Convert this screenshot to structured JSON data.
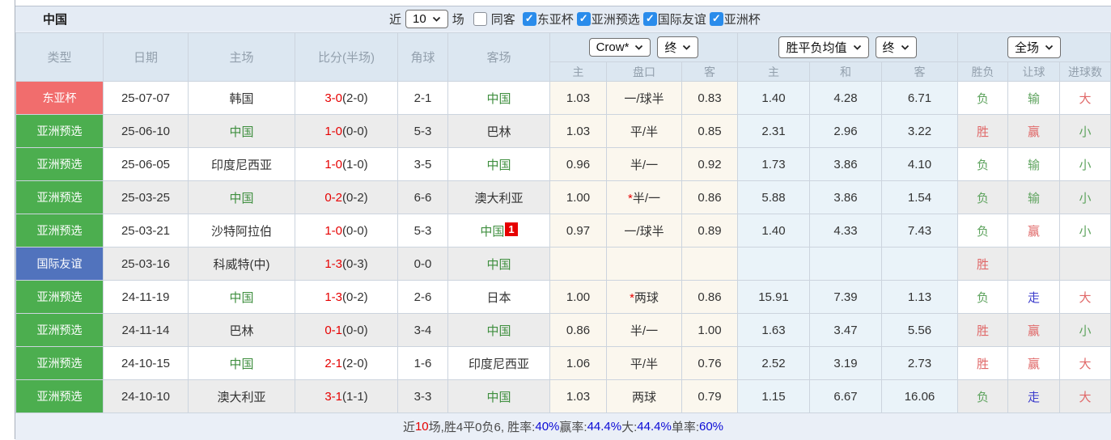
{
  "page": {
    "title": "中国",
    "topbar": {
      "recent_label": "近",
      "recent_count": "10",
      "unit_label": "场",
      "same_away_label": "同客",
      "same_away_checked": false,
      "check_glyph": "✓",
      "filters": [
        {
          "label": "东亚杯",
          "checked": true
        },
        {
          "label": "亚洲预选",
          "checked": true
        },
        {
          "label": "国际友谊",
          "checked": true
        },
        {
          "label": "亚洲杯",
          "checked": true
        }
      ]
    },
    "controls": {
      "company_select": "Crow*",
      "time_select_1": "终",
      "avg_select": "胜平负均值",
      "time_select_2": "终",
      "scope_select": "全场"
    },
    "columns": {
      "type": "类型",
      "date": "日期",
      "home": "主场",
      "score": "比分(半场)",
      "corner": "角球",
      "away": "客场",
      "odds_home": "主",
      "handicap": "盘口",
      "odds_away": "客",
      "avg_home": "主",
      "avg_draw": "和",
      "avg_away": "客",
      "result_wl": "胜负",
      "result_handicap": "让球",
      "result_goals": "进球数"
    },
    "colors": {
      "badge_red": "#f16d6d",
      "badge_green": "#4cae4f",
      "badge_blue": "#5173bd",
      "score_red": "#e60000",
      "team_green": "#3e8e3e",
      "result_red": "#e06868",
      "result_green": "#5ea35e",
      "result_blue": "#3c3ccc",
      "odds_bg_cream": "#fbf7ee",
      "odds_bg_blue": "#eaf3f9",
      "checkbox_blue": "#2a8ceb"
    },
    "rows": [
      {
        "type": "东亚杯",
        "type_color": "red",
        "date": "25-07-07",
        "home": "韩国",
        "home_cn": false,
        "score_ft": "3-0",
        "score_ht": "(2-0)",
        "corner": "2-1",
        "away": "中国",
        "away_cn": true,
        "away_badge": "",
        "odds1": "1.03",
        "hstar": false,
        "handicap": "一/球半",
        "odds2": "0.83",
        "avg1": "1.40",
        "avg2": "4.28",
        "avg3": "6.71",
        "wl": "负",
        "wl_c": "g",
        "let": "输",
        "let_c": "g",
        "goal": "大",
        "goal_c": "r"
      },
      {
        "type": "亚洲预选",
        "type_color": "green",
        "date": "25-06-10",
        "home": "中国",
        "home_cn": true,
        "score_ft": "1-0",
        "score_ht": "(0-0)",
        "corner": "5-3",
        "away": "巴林",
        "away_cn": false,
        "away_badge": "",
        "odds1": "1.03",
        "hstar": false,
        "handicap": "平/半",
        "odds2": "0.85",
        "avg1": "2.31",
        "avg2": "2.96",
        "avg3": "3.22",
        "wl": "胜",
        "wl_c": "r",
        "let": "赢",
        "let_c": "r",
        "goal": "小",
        "goal_c": "g"
      },
      {
        "type": "亚洲预选",
        "type_color": "green",
        "date": "25-06-05",
        "home": "印度尼西亚",
        "home_cn": false,
        "score_ft": "1-0",
        "score_ht": "(1-0)",
        "corner": "3-5",
        "away": "中国",
        "away_cn": true,
        "away_badge": "",
        "odds1": "0.96",
        "hstar": false,
        "handicap": "半/一",
        "odds2": "0.92",
        "avg1": "1.73",
        "avg2": "3.86",
        "avg3": "4.10",
        "wl": "负",
        "wl_c": "g",
        "let": "输",
        "let_c": "g",
        "goal": "小",
        "goal_c": "g"
      },
      {
        "type": "亚洲预选",
        "type_color": "green",
        "date": "25-03-25",
        "home": "中国",
        "home_cn": true,
        "score_ft": "0-2",
        "score_ht": "(0-2)",
        "corner": "6-6",
        "away": "澳大利亚",
        "away_cn": false,
        "away_badge": "",
        "odds1": "1.00",
        "hstar": true,
        "handicap": "半/一",
        "odds2": "0.86",
        "avg1": "5.88",
        "avg2": "3.86",
        "avg3": "1.54",
        "wl": "负",
        "wl_c": "g",
        "let": "输",
        "let_c": "g",
        "goal": "小",
        "goal_c": "g"
      },
      {
        "type": "亚洲预选",
        "type_color": "green",
        "date": "25-03-21",
        "home": "沙特阿拉伯",
        "home_cn": false,
        "score_ft": "1-0",
        "score_ht": "(0-0)",
        "corner": "5-3",
        "away": "中国",
        "away_cn": true,
        "away_badge": "1",
        "odds1": "0.97",
        "hstar": false,
        "handicap": "一/球半",
        "odds2": "0.89",
        "avg1": "1.40",
        "avg2": "4.33",
        "avg3": "7.43",
        "wl": "负",
        "wl_c": "g",
        "let": "赢",
        "let_c": "r",
        "goal": "小",
        "goal_c": "g"
      },
      {
        "type": "国际友谊",
        "type_color": "blue",
        "date": "25-03-16",
        "home": "科威特(中)",
        "home_cn": false,
        "score_ft": "1-3",
        "score_ht": "(0-3)",
        "corner": "0-0",
        "away": "中国",
        "away_cn": true,
        "away_badge": "",
        "odds1": "",
        "hstar": false,
        "handicap": "",
        "odds2": "",
        "avg1": "",
        "avg2": "",
        "avg3": "",
        "wl": "胜",
        "wl_c": "r",
        "let": "",
        "let_c": "g",
        "goal": "",
        "goal_c": "g"
      },
      {
        "type": "亚洲预选",
        "type_color": "green",
        "date": "24-11-19",
        "home": "中国",
        "home_cn": true,
        "score_ft": "1-3",
        "score_ht": "(0-2)",
        "corner": "2-6",
        "away": "日本",
        "away_cn": false,
        "away_badge": "",
        "odds1": "1.00",
        "hstar": true,
        "handicap": "两球",
        "odds2": "0.86",
        "avg1": "15.91",
        "avg2": "7.39",
        "avg3": "1.13",
        "wl": "负",
        "wl_c": "g",
        "let": "走",
        "let_c": "b",
        "goal": "大",
        "goal_c": "r"
      },
      {
        "type": "亚洲预选",
        "type_color": "green",
        "date": "24-11-14",
        "home": "巴林",
        "home_cn": false,
        "score_ft": "0-1",
        "score_ht": "(0-0)",
        "corner": "3-4",
        "away": "中国",
        "away_cn": true,
        "away_badge": "",
        "odds1": "0.86",
        "hstar": false,
        "handicap": "半/一",
        "odds2": "1.00",
        "avg1": "1.63",
        "avg2": "3.47",
        "avg3": "5.56",
        "wl": "胜",
        "wl_c": "r",
        "let": "赢",
        "let_c": "r",
        "goal": "小",
        "goal_c": "g"
      },
      {
        "type": "亚洲预选",
        "type_color": "green",
        "date": "24-10-15",
        "home": "中国",
        "home_cn": true,
        "score_ft": "2-1",
        "score_ht": "(2-0)",
        "corner": "1-6",
        "away": "印度尼西亚",
        "away_cn": false,
        "away_badge": "",
        "odds1": "1.06",
        "hstar": false,
        "handicap": "平/半",
        "odds2": "0.76",
        "avg1": "2.52",
        "avg2": "3.19",
        "avg3": "2.73",
        "wl": "胜",
        "wl_c": "r",
        "let": "赢",
        "let_c": "r",
        "goal": "大",
        "goal_c": "r"
      },
      {
        "type": "亚洲预选",
        "type_color": "green",
        "date": "24-10-10",
        "home": "澳大利亚",
        "home_cn": false,
        "score_ft": "3-1",
        "score_ht": "(1-1)",
        "corner": "3-3",
        "away": "中国",
        "away_cn": true,
        "away_badge": "",
        "odds1": "1.03",
        "hstar": false,
        "handicap": "两球",
        "odds2": "0.79",
        "avg1": "1.15",
        "avg2": "6.67",
        "avg3": "16.06",
        "wl": "负",
        "wl_c": "g",
        "let": "走",
        "let_c": "b",
        "goal": "大",
        "goal_c": "r"
      }
    ],
    "footer": {
      "segments": [
        {
          "text": "近",
          "color": "d"
        },
        {
          "text": "10",
          "color": "r"
        },
        {
          "text": "场,胜4平0负6, 胜率:",
          "color": "d"
        },
        {
          "text": "40%",
          "color": "b"
        },
        {
          "text": " 赢率:",
          "color": "d"
        },
        {
          "text": "44.4%",
          "color": "b"
        },
        {
          "text": " 大:",
          "color": "d"
        },
        {
          "text": "44.4%",
          "color": "b"
        },
        {
          "text": " 单率:",
          "color": "d"
        },
        {
          "text": "60%",
          "color": "b"
        }
      ]
    }
  }
}
